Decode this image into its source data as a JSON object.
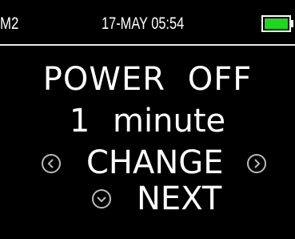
{
  "status_bar": {
    "mode": "M2",
    "datetime": "17-MAY 05:54",
    "battery_color": "#1ed71e",
    "battery_icon": "battery-icon"
  },
  "screen": {
    "title": "POWER OFF",
    "value": "1 minute"
  },
  "controls": {
    "change_label": "CHANGE",
    "next_label": "NEXT",
    "left_icon": "chevron-left-icon",
    "right_icon": "chevron-right-icon",
    "down_icon": "chevron-down-icon"
  }
}
